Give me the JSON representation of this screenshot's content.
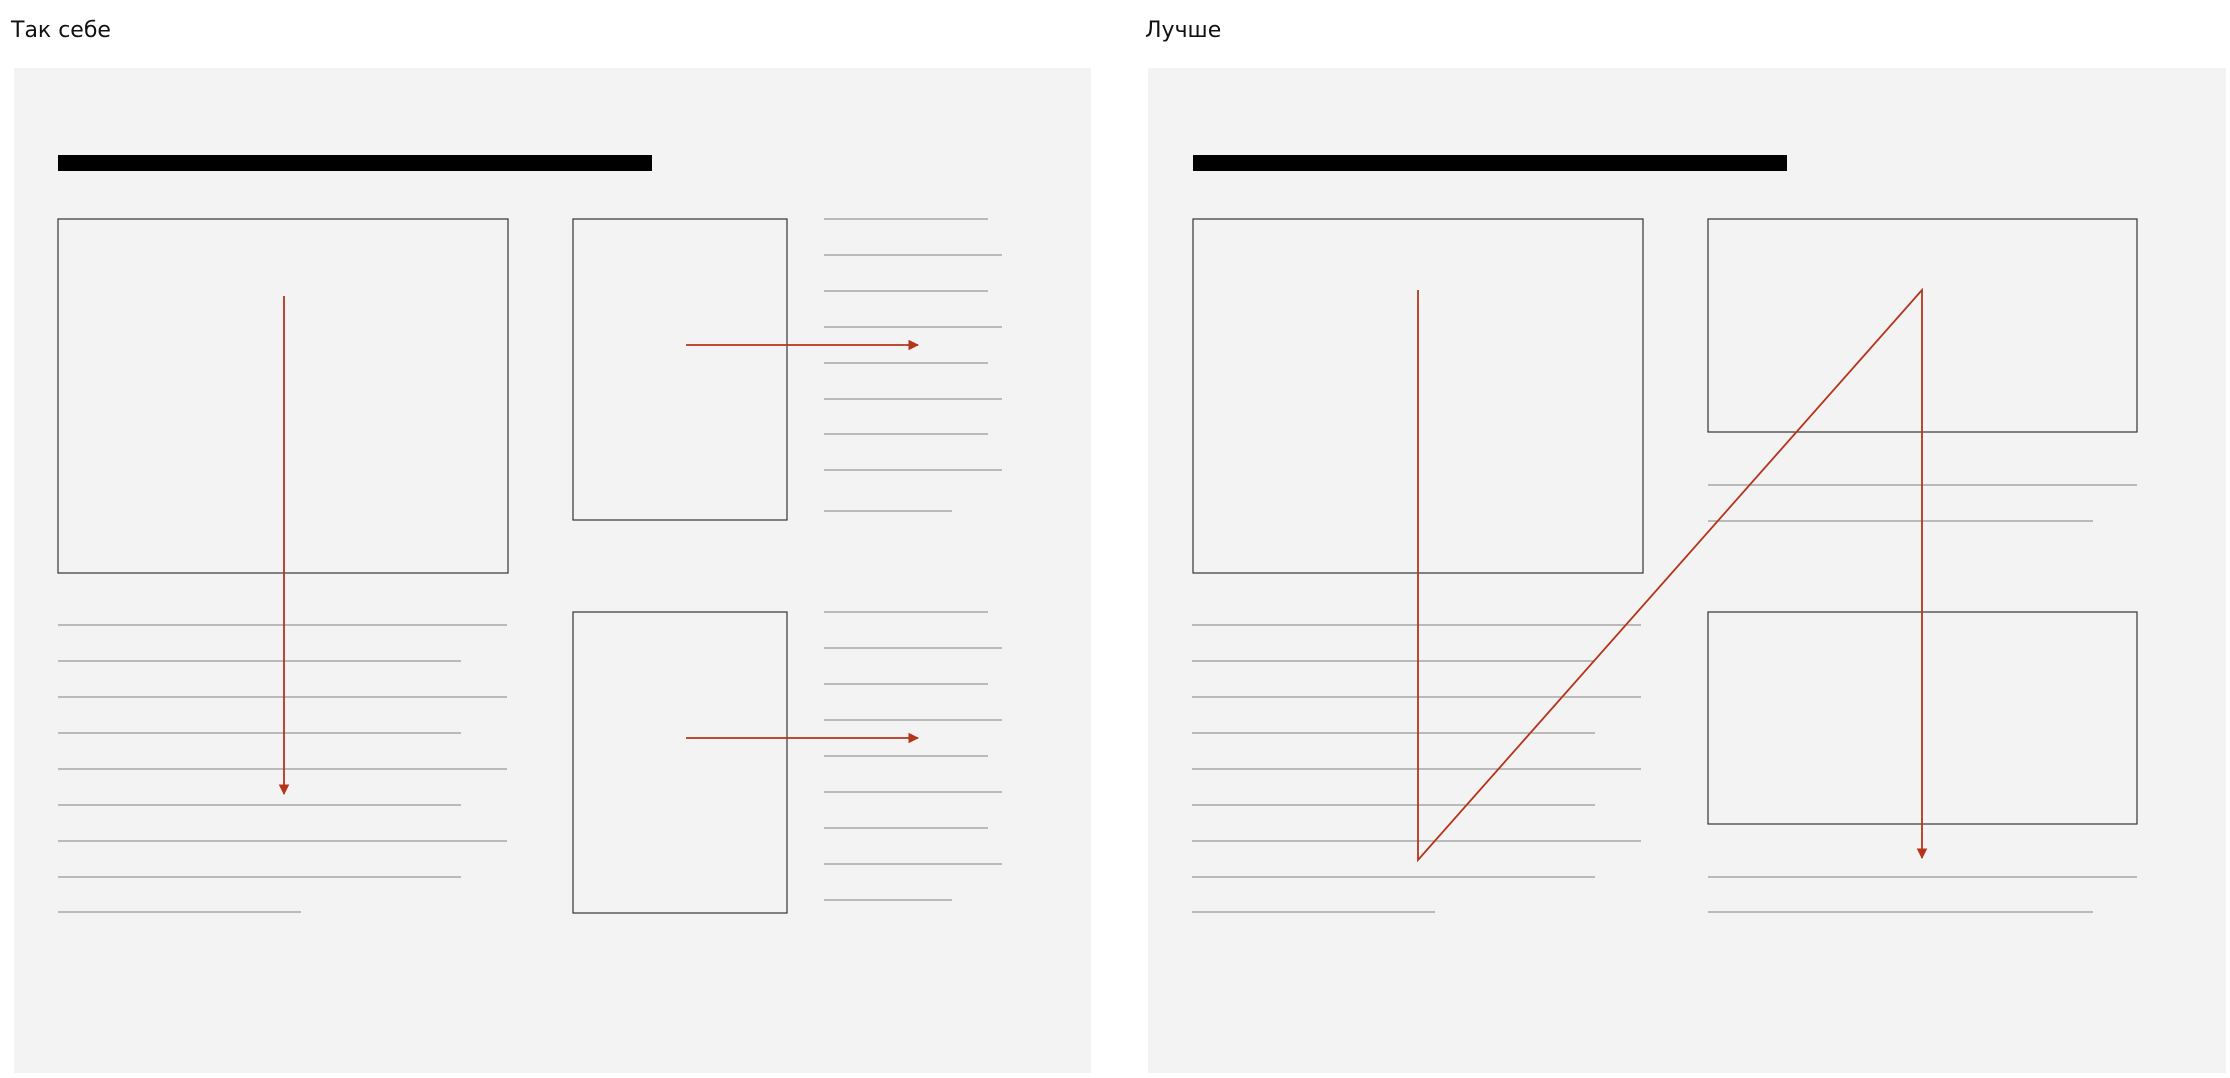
{
  "panels": {
    "left": {
      "title": "Так себе"
    },
    "right": {
      "title": "Лучше"
    }
  },
  "colors": {
    "panel_background": "#f2f3f2",
    "heading_bar": "#000000",
    "frame_stroke": "#333333",
    "text_line": "#a8a8a8",
    "arrow": "#b5351b"
  }
}
